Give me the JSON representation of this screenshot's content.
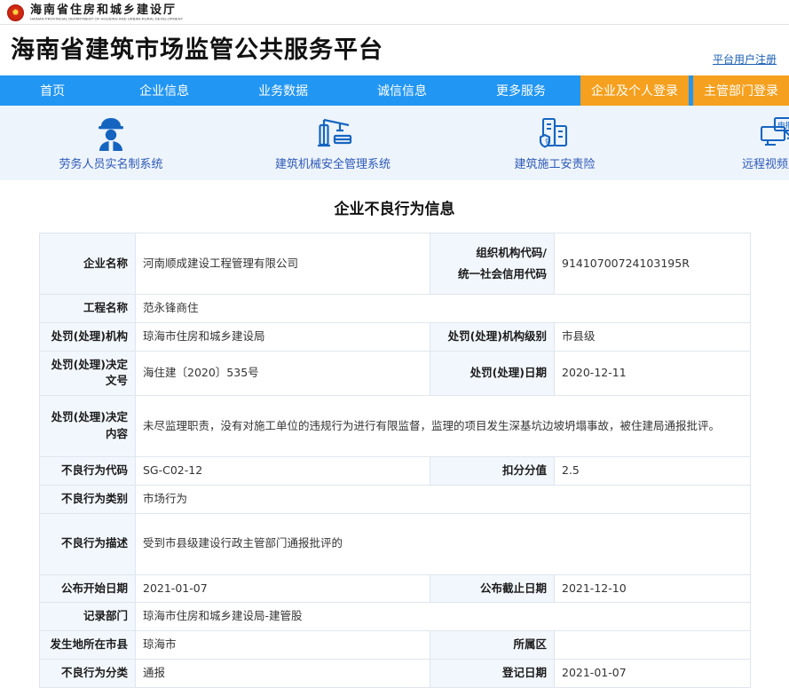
{
  "brand": {
    "cn_name": "海南省住房和城乡建设厅",
    "en_name": "HAINAN PROVINCIAL DEPARTMENT OF HOUSING AND URBAN-RURAL DEVELOPMENT",
    "emblem_icon": "national-emblem-icon"
  },
  "header": {
    "site_title": "海南省建筑市场监管公共服务平台",
    "register_link": "平台用户注册"
  },
  "nav": {
    "items": [
      {
        "label": "首页"
      },
      {
        "label": "企业信息"
      },
      {
        "label": "业务数据"
      },
      {
        "label": "诚信信息"
      },
      {
        "label": "更多服务"
      }
    ],
    "buttons": [
      {
        "label": "企业及个人登录"
      },
      {
        "label": "主管部门登录"
      }
    ],
    "bar_color": "#2196f3",
    "button_color": "#f5a01e"
  },
  "quick_links": [
    {
      "label": "劳务人员实名制系统",
      "icon": "worker-helmet-icon"
    },
    {
      "label": "建筑机械安全管理系统",
      "icon": "tower-crane-icon"
    },
    {
      "label": "建筑施工安责险",
      "icon": "building-shield-icon"
    },
    {
      "label": "远程视频监控",
      "icon": "monitor-declare-icon",
      "badge_text": "申报"
    }
  ],
  "main": {
    "page_title": "企业不良行为信息",
    "rows": [
      {
        "left_label": "企业名称",
        "left_value": "河南顺成建设工程管理有限公司",
        "right_label": "组织机构代码/",
        "right_label2": "统一社会信用代码",
        "right_value": "91410700724103195R"
      },
      {
        "left_label": "工程名称",
        "left_value": "范永锋商住",
        "right_label": "",
        "right_value": ""
      },
      {
        "left_label": "处罚(处理)机构",
        "left_value": "琼海市住房和城乡建设局",
        "right_label": "处罚(处理)机构级别",
        "right_value": "市县级"
      },
      {
        "left_label": "处罚(处理)决定文号",
        "left_value": "海住建〔2020〕535号",
        "right_label": "处罚(处理)日期",
        "right_value": "2020-12-11"
      },
      {
        "left_label": "处罚(处理)决定内容",
        "left_value": "未尽监理职责，没有对施工单位的违规行为进行有限监督，监理的项目发生深基坑边坡坍塌事故，被住建局通报批评。"
      },
      {
        "left_label": "不良行为代码",
        "left_value": "SG-C02-12",
        "right_label": "扣分分值",
        "right_value": "2.5"
      },
      {
        "left_label": "不良行为类别",
        "left_value": "市场行为",
        "right_label": "",
        "right_value": ""
      },
      {
        "left_label": "不良行为描述",
        "left_value": "受到市县级建设行政主管部门通报批评的"
      },
      {
        "left_label": "公布开始日期",
        "left_value": "2021-01-07",
        "right_label": "公布截止日期",
        "right_value": "2021-12-10"
      },
      {
        "left_label": "记录部门",
        "left_value": "琼海市住房和城乡建设局-建管股",
        "right_label": "",
        "right_value": ""
      },
      {
        "left_label": "发生地所在市县",
        "left_value": "琼海市",
        "right_label": "所属区",
        "right_value": ""
      },
      {
        "left_label": "不良行为分类",
        "left_value": "通报",
        "right_label": "登记日期",
        "right_value": "2021-01-07"
      }
    ]
  }
}
